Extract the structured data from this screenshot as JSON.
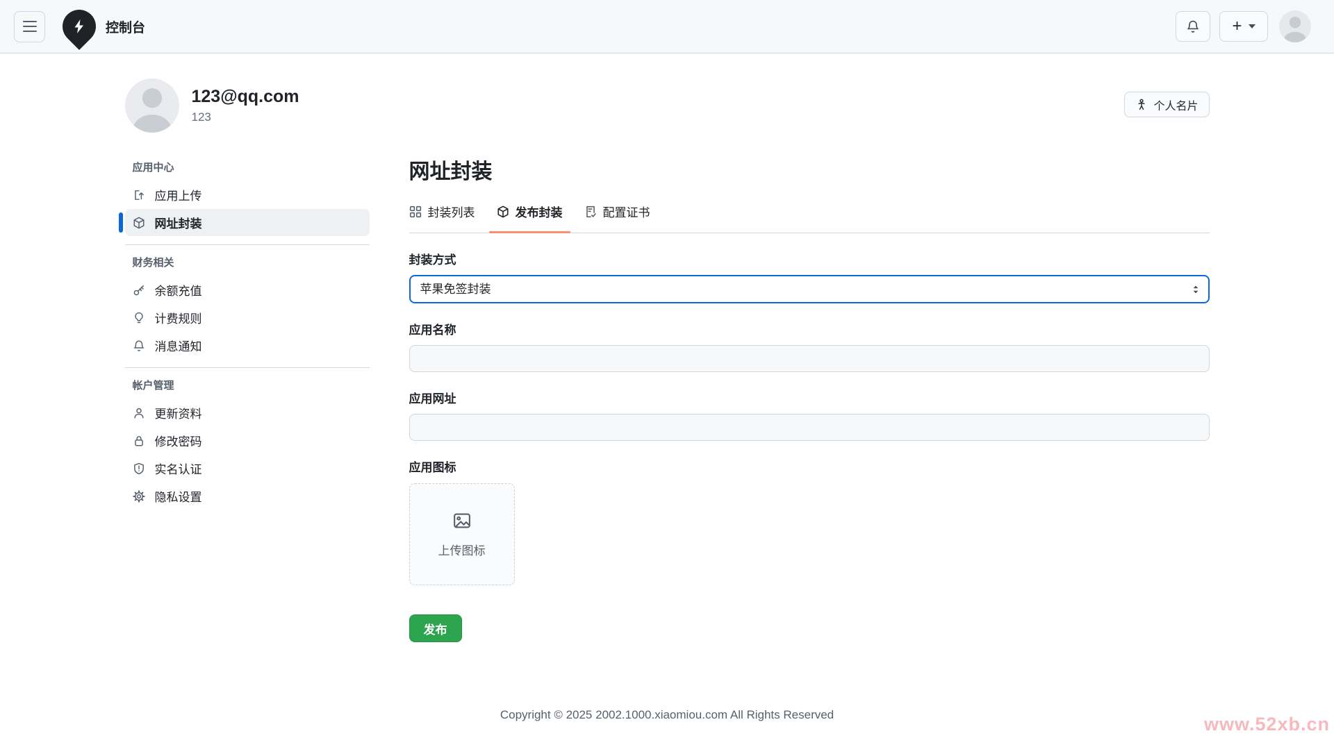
{
  "header": {
    "title": "控制台",
    "icons": [
      "menu-icon",
      "bolt-logo-icon",
      "bell-icon",
      "plus-icon",
      "caret-down-icon",
      "avatar"
    ]
  },
  "profile": {
    "email": "123@qq.com",
    "username": "123",
    "card_button_label": "个人名片",
    "card_button_icon": "person-standing-icon"
  },
  "sidebar": {
    "sections": [
      {
        "label": "应用中心",
        "items": [
          {
            "label": "应用上传",
            "icon": "upload-icon",
            "active": false
          },
          {
            "label": "网址封装",
            "icon": "package-icon",
            "active": true
          }
        ]
      },
      {
        "label": "财务相关",
        "items": [
          {
            "label": "余额充值",
            "icon": "key-icon",
            "active": false
          },
          {
            "label": "计费规则",
            "icon": "lightbulb-icon",
            "active": false
          },
          {
            "label": "消息通知",
            "icon": "bell-icon",
            "active": false
          }
        ]
      },
      {
        "label": "帐户管理",
        "items": [
          {
            "label": "更新资料",
            "icon": "person-icon",
            "active": false
          },
          {
            "label": "修改密码",
            "icon": "lock-icon",
            "active": false
          },
          {
            "label": "实名认证",
            "icon": "shield-icon",
            "active": false
          },
          {
            "label": "隐私设置",
            "icon": "gear-icon",
            "active": false
          }
        ]
      }
    ]
  },
  "main": {
    "title": "网址封装",
    "tabs": [
      {
        "label": "封装列表",
        "icon": "apps-grid-icon",
        "active": false
      },
      {
        "label": "发布封装",
        "icon": "package-icon",
        "active": true
      },
      {
        "label": "配置证书",
        "icon": "file-check-icon",
        "active": false
      }
    ],
    "form": {
      "method_label": "封装方式",
      "method_value": "苹果免签封装",
      "name_label": "应用名称",
      "name_value": "",
      "url_label": "应用网址",
      "url_value": "",
      "icon_label": "应用图标",
      "upload_text": "上传图标",
      "upload_icon": "image-icon",
      "submit_label": "发布"
    }
  },
  "footer": {
    "copyright": "Copyright © 2025 2002.1000.xiaomiou.com All Rights Reserved"
  },
  "watermark": {
    "text": "www.52xb.cn"
  },
  "colors": {
    "accent_blue": "#0969da",
    "success_green": "#2da44e",
    "tab_underline": "#fd8c73",
    "header_bg": "#f6f8fa",
    "border": "#d0d7de",
    "muted_text": "#57606a",
    "watermark_pink": "#f6b9bd"
  }
}
